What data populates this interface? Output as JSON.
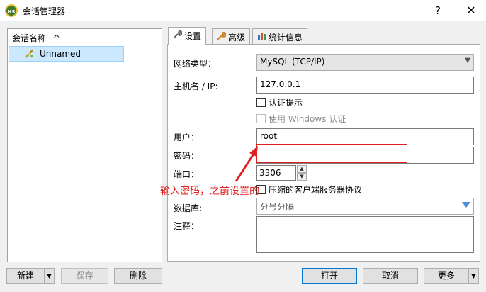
{
  "window": {
    "icon_text": "HS",
    "title": "会话管理器",
    "help_glyph": "?",
    "close_glyph": "✕"
  },
  "sidebar": {
    "header": "会话名称",
    "sort_glyph": "^",
    "items": [
      {
        "label": "Unnamed",
        "selected": true
      }
    ]
  },
  "tabs": [
    {
      "label": "设置",
      "active": true,
      "icon": "wrench-icon"
    },
    {
      "label": "高级",
      "active": false,
      "icon": "wrench-icon"
    },
    {
      "label": "统计信息",
      "active": false,
      "icon": "bar-chart-icon"
    }
  ],
  "settings": {
    "network_type_label": "网络类型：",
    "network_type_value": "MySQL (TCP/IP)",
    "host_label": "主机名 / IP:",
    "host_value": "127.0.0.1",
    "prompt_auth_label": "认证提示",
    "windows_auth_label": "使用 Windows 认证",
    "user_label": "用户：",
    "user_value": "root",
    "password_label": "密码：",
    "password_value": "",
    "port_label": "端口：",
    "port_value": "3306",
    "compress_label": "压缩的客户端服务器协议",
    "database_label": "数据库:",
    "database_placeholder": "分号分隔",
    "notes_label": "注释："
  },
  "annotation": {
    "text": "输入密码，之前设置的",
    "color": "#e02020"
  },
  "bottom_buttons": {
    "new": "新建",
    "save": "保存",
    "delete": "删除",
    "open": "打开",
    "cancel": "取消",
    "more": "更多"
  },
  "colors": {
    "selection": "#cce8ff",
    "default_button_border": "#0078d7"
  }
}
